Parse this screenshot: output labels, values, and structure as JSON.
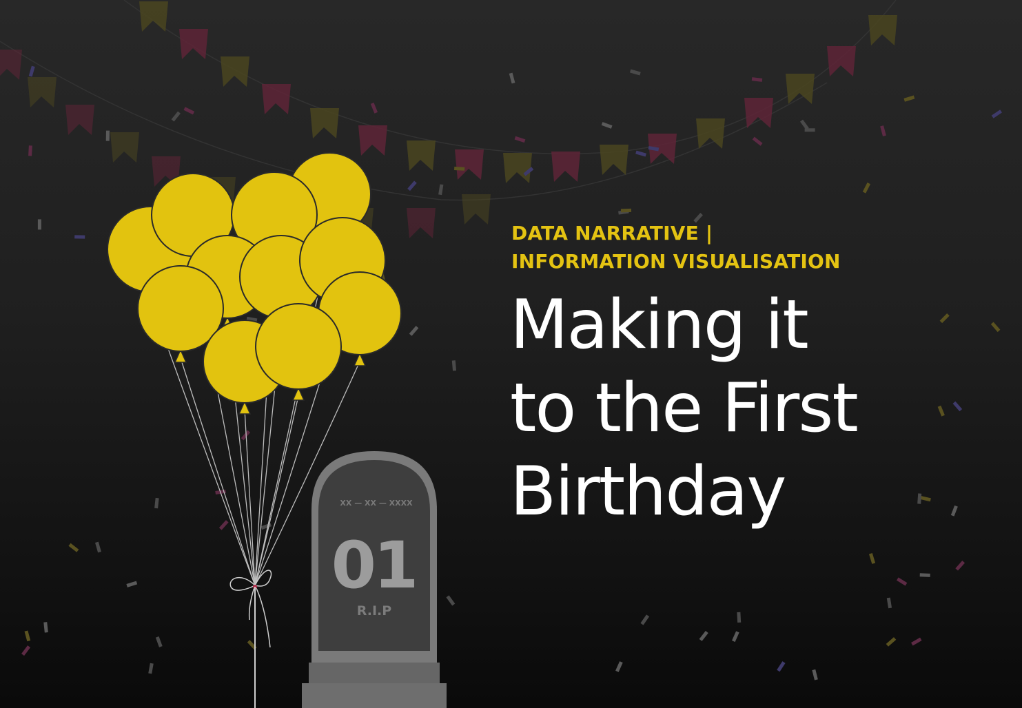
{
  "kicker": {
    "line1": "DATA NARRATIVE |",
    "line2": "INFORMATION VISUALISATION"
  },
  "headline": {
    "line1": "Making it",
    "line2": "to the First",
    "line3": "Birthday"
  },
  "tombstone": {
    "date": "XX — XX — XXXX",
    "number": "01",
    "epitaph": "R.I.P"
  },
  "colors": {
    "accent": "#e4c312",
    "balloon": "#e2c30f",
    "text": "#ffffff",
    "tombstone": "#7a7a7a",
    "pennant_red": "#5e2437",
    "pennant_olive": "#4a4520"
  },
  "icons": [
    "balloon-bunch-icon",
    "tombstone-icon",
    "bunting-icon",
    "confetti-icon"
  ]
}
